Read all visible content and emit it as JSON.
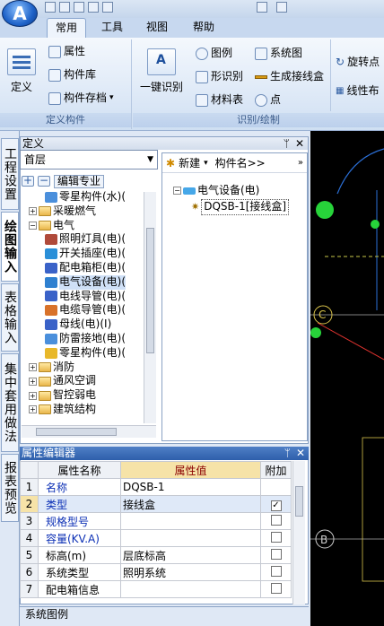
{
  "app": {
    "logo_letter": "A"
  },
  "tabs": [
    {
      "label": "常用"
    },
    {
      "label": "工具"
    },
    {
      "label": "视图"
    },
    {
      "label": "帮助"
    }
  ],
  "ribbon": {
    "define_group": {
      "label": "定义构件",
      "define": "定义",
      "attribute": "属性",
      "component_lib": "构件库",
      "component_save": "构件存档"
    },
    "recognize_group": {
      "label": "识别/绘制",
      "one_click": "一键识别",
      "legend": "图例",
      "shape_recog": "形识别",
      "material": "材料表",
      "system_diagram": "系统图",
      "gen_wire": "生成接线盒",
      "point": "点",
      "rotate_point": "旋转点",
      "line_layout": "线性布"
    }
  },
  "vertical_tabs": [
    {
      "label": "工程设置"
    },
    {
      "label": "绘图输入"
    },
    {
      "label": "表格输入"
    },
    {
      "label": "集中套用做法"
    },
    {
      "label": "报表预览"
    }
  ],
  "define_panel": {
    "title": "定义",
    "floor": "首层",
    "edit_major": "编辑专业",
    "tree": [
      {
        "label": "零星构件(水)(",
        "level": 2,
        "kind": "item"
      },
      {
        "label": "采暖燃气",
        "level": 1,
        "kind": "folder",
        "expanded": false
      },
      {
        "label": "电气",
        "level": 1,
        "kind": "folder",
        "expanded": true
      },
      {
        "label": "照明灯具(电)(",
        "level": 2,
        "kind": "item"
      },
      {
        "label": "开关插座(电)(",
        "level": 2,
        "kind": "item"
      },
      {
        "label": "配电箱柜(电)(",
        "level": 2,
        "kind": "item"
      },
      {
        "label": "电气设备(电)(",
        "level": 2,
        "kind": "item",
        "selected": true
      },
      {
        "label": "电线导管(电)(",
        "level": 2,
        "kind": "item"
      },
      {
        "label": "电缆导管(电)(",
        "level": 2,
        "kind": "item"
      },
      {
        "label": "母线(电)(I)",
        "level": 2,
        "kind": "item"
      },
      {
        "label": "防雷接地(电)(",
        "level": 2,
        "kind": "item"
      },
      {
        "label": "零星构件(电)(",
        "level": 2,
        "kind": "item"
      },
      {
        "label": "消防",
        "level": 1,
        "kind": "folder",
        "expanded": false
      },
      {
        "label": "通风空调",
        "level": 1,
        "kind": "folder",
        "expanded": false
      },
      {
        "label": "智控弱电",
        "level": 1,
        "kind": "folder",
        "expanded": false
      },
      {
        "label": "建筑结构",
        "level": 1,
        "kind": "folder",
        "expanded": false
      }
    ],
    "right_toolbar": {
      "new": "新建",
      "component_name": "构件名>>"
    },
    "right_tree": {
      "parent": "电气设备(电)",
      "child": "DQSB-1[接线盒]"
    }
  },
  "property_editor": {
    "title": "属性编辑器",
    "columns": [
      "属性名称",
      "属性值",
      "附加"
    ],
    "rows": [
      {
        "no": "1",
        "name": "名称",
        "value": "DQSB-1",
        "blue": true,
        "has_check": false,
        "checked": false
      },
      {
        "no": "2",
        "name": "类型",
        "value": "接线盒",
        "blue": true,
        "has_check": true,
        "checked": true
      },
      {
        "no": "3",
        "name": "规格型号",
        "value": "",
        "blue": true,
        "has_check": true,
        "checked": false
      },
      {
        "no": "4",
        "name": "容量(KV.A)",
        "value": "",
        "blue": true,
        "has_check": true,
        "checked": false
      },
      {
        "no": "5",
        "name": "标高(m)",
        "value": "层底标高",
        "blue": false,
        "has_check": true,
        "checked": false
      },
      {
        "no": "6",
        "name": "系统类型",
        "value": "照明系统",
        "blue": false,
        "has_check": true,
        "checked": false
      },
      {
        "no": "7",
        "name": "配电箱信息",
        "value": "",
        "blue": false,
        "has_check": true,
        "checked": false
      }
    ]
  },
  "system_legend": "系统图例",
  "canvas": {
    "labels": [
      "C",
      "B"
    ]
  },
  "colors": {
    "ribbon_bg": "#dbe7f6",
    "prop_header": "#2e5fab",
    "accent_blue": "#0b2fb5",
    "canvas_bg": "#000000"
  }
}
